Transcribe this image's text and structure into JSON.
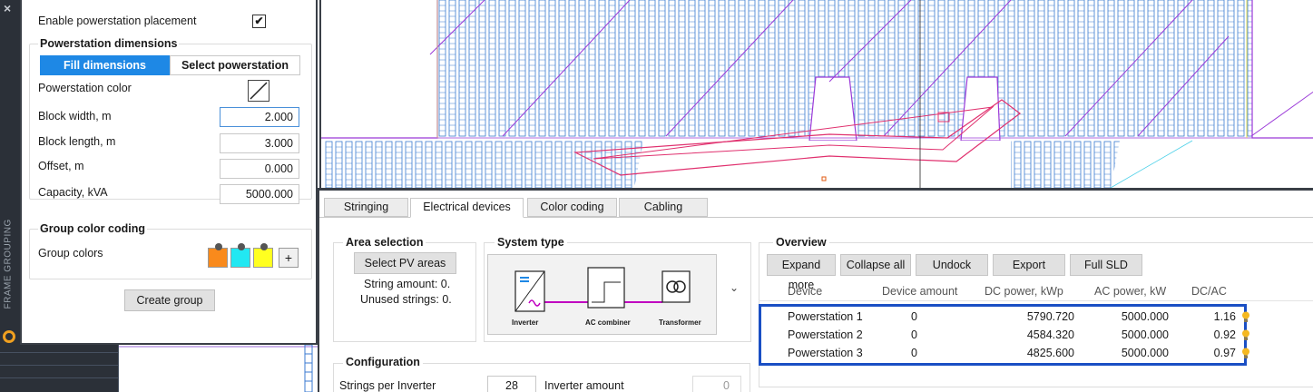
{
  "sidebar": {
    "close_glyph": "×",
    "vertical_label": "FRAME GROUPING"
  },
  "left_panel": {
    "enable_label": "Enable powerstation placement",
    "enable_checked": "✔",
    "dimensions_title": "Powerstation dimensions",
    "fill_tab": "Fill dimensions",
    "select_tab": "Select powerstation",
    "color_label": "Powerstation color",
    "fields": [
      {
        "label": "Block width, m",
        "value": "2.000"
      },
      {
        "label": "Block length, m",
        "value": "3.000"
      },
      {
        "label": "Offset, m",
        "value": "0.000"
      },
      {
        "label": "Capacity, kVA",
        "value": "5000.000"
      }
    ],
    "group_color_title": "Group color coding",
    "group_colors_label": "Group colors",
    "group_colors": [
      "#f98a1c",
      "#22e8f2",
      "#ffff20"
    ],
    "add_glyph": "+",
    "create_group": "Create group"
  },
  "tabs": [
    "Stringing",
    "Electrical devices",
    "Color coding",
    "Cabling"
  ],
  "area_selection": {
    "title": "Area selection",
    "select_btn": "Select PV areas",
    "string_amount": "String amount: 0.",
    "unused_strings": "Unused strings: 0."
  },
  "system_type": {
    "title": "System type",
    "devices": [
      "Inverter",
      "AC combiner",
      "Transformer"
    ],
    "chevron": "⌄"
  },
  "configuration": {
    "title": "Configuration",
    "strings_label": "Strings per Inverter",
    "strings_value": "28",
    "inverter_label": "Inverter amount",
    "inverter_value": "0"
  },
  "overview": {
    "title": "Overview",
    "buttons": [
      "Expand more",
      "Collapse all",
      "Undock",
      "Export",
      "Full SLD"
    ],
    "columns": [
      "Device",
      "Device amount",
      "DC power, kWp",
      "AC power, kW",
      "DC/AC"
    ],
    "rows": [
      {
        "device": "Powerstation 1",
        "amount": "0",
        "dc": "5790.720",
        "ac": "5000.000",
        "ratio": "1.16"
      },
      {
        "device": "Powerstation 2",
        "amount": "0",
        "dc": "4584.320",
        "ac": "5000.000",
        "ratio": "0.92"
      },
      {
        "device": "Powerstation 3",
        "amount": "0",
        "dc": "4825.600",
        "ac": "5000.000",
        "ratio": "0.97"
      }
    ],
    "highlight_color": "#1a4fc4"
  }
}
